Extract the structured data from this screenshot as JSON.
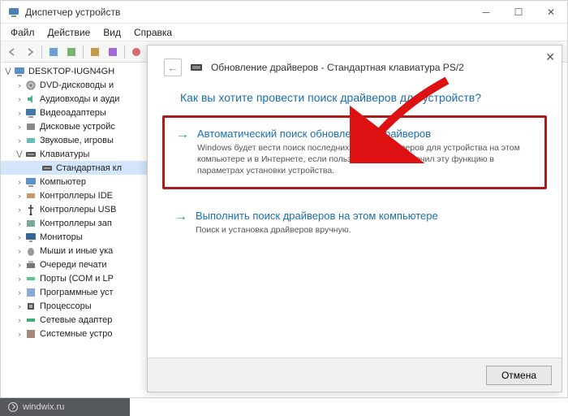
{
  "window": {
    "title": "Диспетчер устройств"
  },
  "menu": {
    "file": "Файл",
    "action": "Действие",
    "view": "Вид",
    "help": "Справка"
  },
  "tree": {
    "root": "DESKTOP-IUGN4GH",
    "items": [
      {
        "label": "DVD-дисководы и",
        "icon": "disc"
      },
      {
        "label": "Аудиовходы и ауди",
        "icon": "audio"
      },
      {
        "label": "Видеоадаптеры",
        "icon": "display"
      },
      {
        "label": "Дисковые устройс",
        "icon": "disk"
      },
      {
        "label": "Звуковые, игровы",
        "icon": "sound"
      },
      {
        "label": "Клавиатуры",
        "icon": "keyboard",
        "expanded": true
      },
      {
        "label": "Стандартная кл",
        "icon": "keyboard",
        "child": true,
        "selected": true
      },
      {
        "label": "Компьютер",
        "icon": "computer"
      },
      {
        "label": "Контроллеры IDE",
        "icon": "ide"
      },
      {
        "label": "Контроллеры USB",
        "icon": "usb"
      },
      {
        "label": "Контроллеры зап",
        "icon": "storage"
      },
      {
        "label": "Мониторы",
        "icon": "monitor"
      },
      {
        "label": "Мыши и иные ука",
        "icon": "mouse"
      },
      {
        "label": "Очереди печати",
        "icon": "printer"
      },
      {
        "label": "Порты (COM и LP",
        "icon": "port"
      },
      {
        "label": "Программные уст",
        "icon": "soft"
      },
      {
        "label": "Процессоры",
        "icon": "cpu"
      },
      {
        "label": "Сетевые адаптер",
        "icon": "net"
      },
      {
        "label": "Системные устро",
        "icon": "sys"
      }
    ]
  },
  "dialog": {
    "title": "Обновление драйверов - Стандартная клавиатура PS/2",
    "question": "Как вы хотите провести поиск драйверов для устройств?",
    "opt1": {
      "title": "Автоматический поиск обновленных драйверов",
      "desc": "Windows будет вести поиск последних версий драйверов для устройства на этом компьютере и в Интернете, если пользователь не отключил эту функцию в параметрах установки устройства."
    },
    "opt2": {
      "title": "Выполнить поиск драйверов на этом компьютере",
      "desc": "Поиск и установка драйверов вручную."
    },
    "cancel": "Отмена"
  },
  "watermark": "windwix.ru"
}
